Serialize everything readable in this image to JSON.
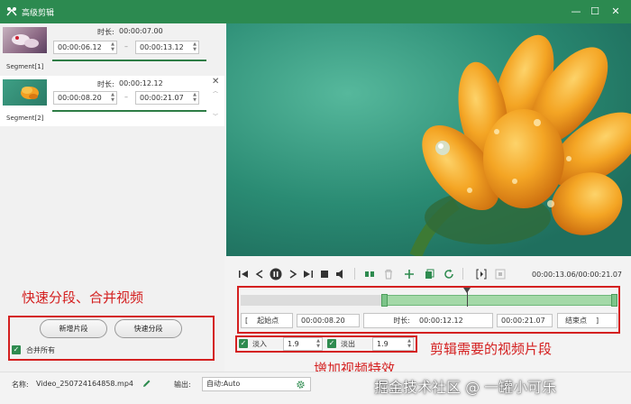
{
  "window": {
    "title": "高级剪辑"
  },
  "segments": [
    {
      "name": "Segment[1]",
      "duration_label": "时长:",
      "duration": "00:00:07.00",
      "start": "00:00:06.12",
      "end": "00:00:13.12"
    },
    {
      "name": "Segment[2]",
      "duration_label": "时长:",
      "duration": "00:00:12.12",
      "start": "00:00:08.20",
      "end": "00:00:21.07"
    }
  ],
  "annotations": {
    "left": "快速分段、合并视频",
    "right": "剪辑需要的视频片段",
    "effects": "增加视频特效",
    "watermark": "掘金技术社区 @ 一罐小可乐"
  },
  "buttons": {
    "new_segment": "新增片段",
    "quick_split": "快速分段"
  },
  "merge_all": {
    "label": "合并所有",
    "checked": true
  },
  "playback": {
    "time": "00:00:13.06/00:00:21.07"
  },
  "range": {
    "start_btn": "起始点",
    "start": "00:00:08.20",
    "duration_label": "时长:",
    "duration": "00:00:12.12",
    "end": "00:00:21.07",
    "end_btn": "结束点",
    "selected_start_fraction": 0.38,
    "selected_end_fraction": 1.0,
    "playhead_fraction": 0.6
  },
  "effects": {
    "fade_in": {
      "label": "淡入",
      "value": "1.9",
      "checked": true
    },
    "fade_out": {
      "label": "淡出",
      "value": "1.9",
      "checked": true
    }
  },
  "file": {
    "name_label": "名称:",
    "name": "Video_250724164858.mp4",
    "output_label": "输出:",
    "output": "自动:Auto"
  },
  "colors": {
    "title_bar": "#2c8a50",
    "accent_green": "#2e8b4f",
    "annotation_red": "#d42020"
  }
}
